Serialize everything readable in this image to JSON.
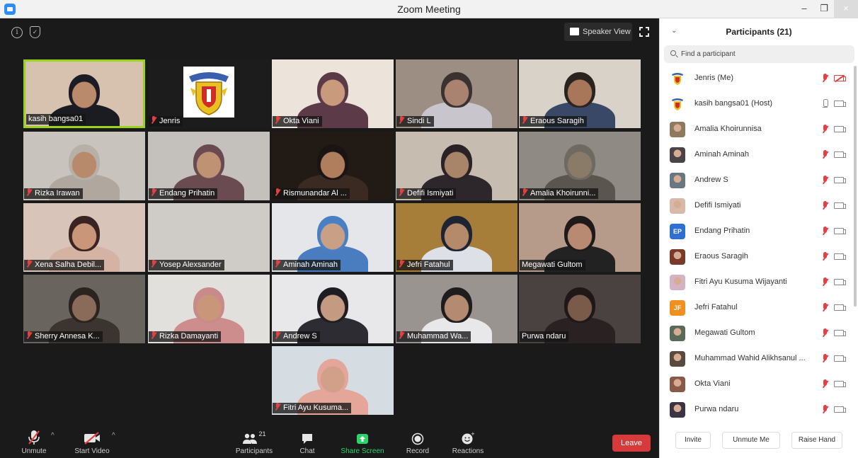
{
  "window": {
    "title": "Zoom Meeting",
    "minimize": "–",
    "restore": "❐",
    "close": "×"
  },
  "top": {
    "speaker_view": "Speaker View"
  },
  "tiles": [
    {
      "name": "kasih bangsa01",
      "muted": false,
      "active": true,
      "bg": "#d7c2b0",
      "skin": "#b98a6c",
      "head": "#1c1c24",
      "body": "#1b1b22"
    },
    {
      "name": "Jenris",
      "muted": true,
      "logo": true,
      "bg": "#1c1c1c"
    },
    {
      "name": "Okta Viani",
      "muted": true,
      "bg": "#ece4da",
      "skin": "#c99a7c",
      "head": "#5a3a46",
      "body": "#5c3a47"
    },
    {
      "name": "Sindi L",
      "muted": true,
      "bg": "#9c8e82",
      "skin": "#a98370",
      "head": "#3a3230",
      "body": "#c8c6cc"
    },
    {
      "name": "Eraous Saragih",
      "muted": true,
      "bg": "#d9d2c8",
      "skin": "#a87658",
      "head": "#2a2420",
      "body": "#3a4868"
    },
    {
      "name": "Rizka Irawan",
      "muted": true,
      "bg": "#c9c3bd",
      "skin": "#b88a6c",
      "head": "#b7b0a6",
      "body": "#b0a89f"
    },
    {
      "name": "Endang Prihatin",
      "muted": true,
      "bg": "#c4c0bc",
      "skin": "#c09274",
      "head": "#6a4a50",
      "body": "#6b4b52"
    },
    {
      "name": "Rismunandar Al ...",
      "muted": true,
      "bg": "#221a14",
      "skin": "#b07e5c",
      "head": "#1a1412",
      "body": "#3a2a22"
    },
    {
      "name": "Defifi Ismiyati",
      "muted": true,
      "bg": "#c7bcb0",
      "skin": "#a88468",
      "head": "#2a2226",
      "body": "#2d262b"
    },
    {
      "name": "Amalia Khoirunni...",
      "muted": true,
      "bg": "#8f8b84",
      "skin": "#8a7a68",
      "head": "#6e6a62",
      "body": "#5a564f"
    },
    {
      "name": "Xena Salha Debil...",
      "muted": true,
      "bg": "#d8c4b8",
      "skin": "#c9967a",
      "head": "#3a2422",
      "body": "#d4b2a4"
    },
    {
      "name": "Yosep Alexsander",
      "muted": true,
      "bg": "#cfcbc6",
      "empty": true
    },
    {
      "name": "Aminah Aminah",
      "muted": true,
      "bg": "#e4e6ea",
      "skin": "#c9a086",
      "head": "#4b7fc4",
      "body": "#4a7dc0"
    },
    {
      "name": "Jefri Fatahul",
      "muted": true,
      "bg": "#a77d3a",
      "skin": "#b58a6a",
      "head": "#1e2432",
      "body": "#dde0e6"
    },
    {
      "name": "Megawati Gultom",
      "muted": false,
      "bg": "#b79b8a",
      "skin": "#b88a72",
      "head": "#1e1a1a",
      "body": "#222"
    },
    {
      "name": "Sherry Annesa K...",
      "muted": true,
      "bg": "#6a645e",
      "skin": "#8a6a58",
      "head": "#2a2320",
      "body": "#3b3430"
    },
    {
      "name": "Rizka Damayanti",
      "muted": true,
      "bg": "#e2e0dc",
      "skin": "#c9967a",
      "head": "#c98a8a",
      "body": "#cc8d8c"
    },
    {
      "name": "Andrew S",
      "muted": true,
      "bg": "#e8e8ea",
      "skin": "#c49a80",
      "head": "#1e1e22",
      "body": "#2c2c32"
    },
    {
      "name": "Muhammad Wa...",
      "muted": true,
      "bg": "#9a9490",
      "skin": "#b48a70",
      "head": "#1e1c1c",
      "body": "#e8e8ea"
    },
    {
      "name": "Purwa ndaru",
      "muted": false,
      "bg": "#4a4240",
      "skin": "#7a5a48",
      "head": "#1e1818",
      "body": "#2a2222"
    },
    {
      "name": "Fitri Ayu Kusuma...",
      "muted": true,
      "bg": "#d6dde2",
      "skin": "#d2a088",
      "head": "#e4a59a",
      "body": "#e3a698"
    }
  ],
  "toolbar": {
    "unmute": "Unmute",
    "start_video": "Start Video",
    "participants": "Participants",
    "participants_count": "21",
    "chat": "Chat",
    "share_screen": "Share Screen",
    "record": "Record",
    "reactions": "Reactions",
    "leave": "Leave"
  },
  "panel": {
    "title": "Participants (21)",
    "search_placeholder": "Find a participant",
    "participants": [
      {
        "name": "Jenris (Me)",
        "avatar": "logo",
        "mic": "muted",
        "cam": "off"
      },
      {
        "name": "kasih bangsa01 (Host)",
        "avatar": "logo",
        "mic": "on",
        "cam": "on"
      },
      {
        "name": "Amalia Khoirunnisa",
        "avatar": "photo",
        "color": "#8f7a60",
        "mic": "muted",
        "cam": "on"
      },
      {
        "name": "Aminah Aminah",
        "avatar": "photo",
        "color": "#4a4448",
        "mic": "muted",
        "cam": "on"
      },
      {
        "name": "Andrew S",
        "avatar": "photo",
        "color": "#6a7680",
        "mic": "muted",
        "cam": "on"
      },
      {
        "name": "Defifi Ismiyati",
        "avatar": "photo",
        "color": "#d8b8a8",
        "mic": "muted",
        "cam": "on"
      },
      {
        "name": "Endang Prihatin",
        "avatar": "initials",
        "initials": "EP",
        "color": "#2f6fd2",
        "mic": "muted",
        "cam": "on"
      },
      {
        "name": "Eraous Saragih",
        "avatar": "photo",
        "color": "#7a3a2a",
        "mic": "muted",
        "cam": "on"
      },
      {
        "name": "Fitri Ayu Kusuma Wijayanti",
        "avatar": "photo",
        "color": "#d4b4c4",
        "mic": "muted",
        "cam": "on"
      },
      {
        "name": "Jefri Fatahul",
        "avatar": "initials",
        "initials": "JF",
        "color": "#f0901e",
        "mic": "muted",
        "cam": "on"
      },
      {
        "name": "Megawati Gultom",
        "avatar": "photo",
        "color": "#5a6a5a",
        "mic": "muted",
        "cam": "on"
      },
      {
        "name": "Muhammad Wahid Alikhsanul ...",
        "avatar": "photo",
        "color": "#5a4a3e",
        "mic": "muted",
        "cam": "on"
      },
      {
        "name": "Okta Viani",
        "avatar": "photo",
        "color": "#8a5a48",
        "mic": "muted",
        "cam": "on"
      },
      {
        "name": "Purwa ndaru",
        "avatar": "photo",
        "color": "#3a3444",
        "mic": "muted",
        "cam": "on"
      }
    ],
    "invite": "Invite",
    "unmute_me": "Unmute Me",
    "raise_hand": "Raise Hand"
  }
}
